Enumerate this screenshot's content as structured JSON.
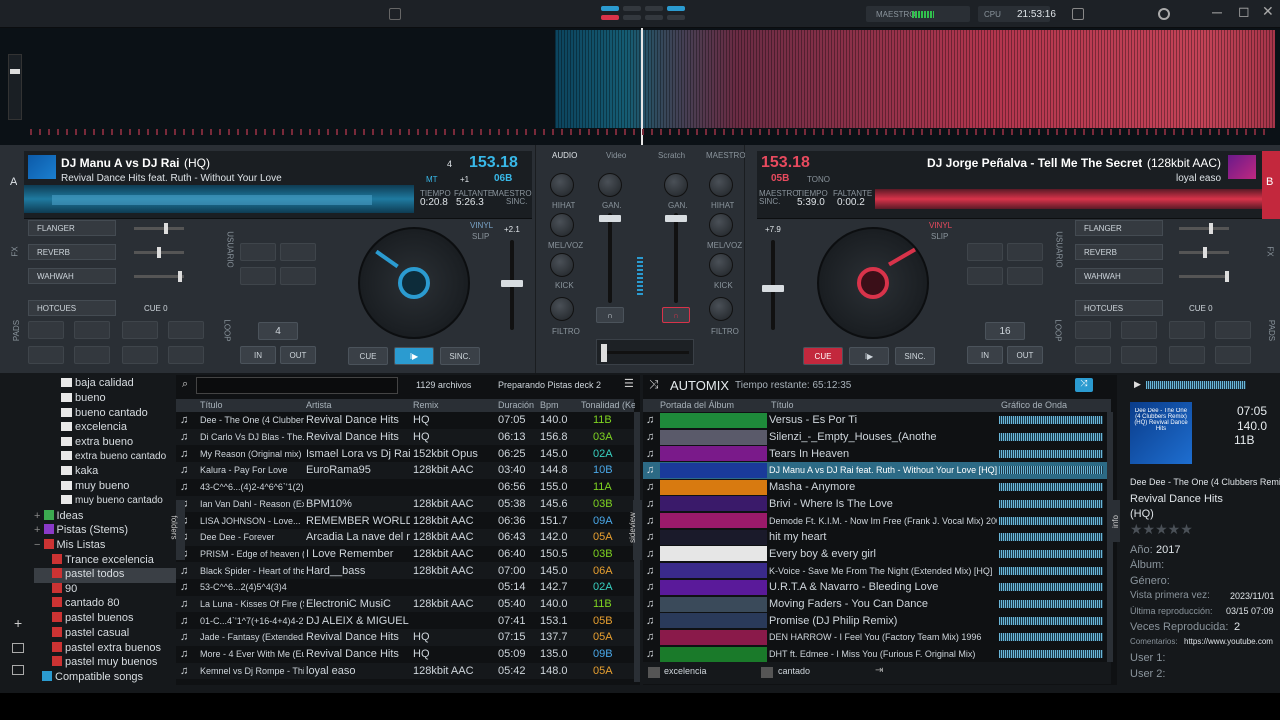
{
  "topbar": {
    "master_label": "MAESTRO",
    "cpu_label": "CPU",
    "clock": "21:53:16"
  },
  "deckA": {
    "letter": "A",
    "title": "DJ Manu A vs DJ Rai",
    "title_tag": "(HQ)",
    "subtitle": "Revival Dance Hits feat. Ruth - Without Your Love",
    "bpm": "153.18",
    "mt": "MT",
    "pitch": "+1",
    "key": "06B",
    "small_num": "4",
    "time_label": "TIEMPO",
    "time": "0:20.8",
    "remain_label": "FALTANTE",
    "remain": "5:26.3",
    "master_label": "MAESTRO",
    "sync_label": "SINC.",
    "fx": [
      "FLANGER",
      "REVERB",
      "WAHWAH"
    ],
    "hotcues": "HOTCUES",
    "cue_label": "CUE 0",
    "loop_val": "4",
    "in": "IN",
    "out": "OUT",
    "cue": "CUE",
    "sync": "SINC.",
    "pitch_val": "+2.1",
    "vinyl": "VINYL",
    "slip": "SLIP",
    "side_fx": "FX",
    "side_pads": "PADS",
    "side_user": "USUARIO",
    "side_loop": "LOOP"
  },
  "deckB": {
    "letter": "B",
    "title": "DJ Jorge Peñalva - Tell Me The Secret",
    "title_tag": "(128kbit AAC)",
    "subtitle": "loyal easo",
    "bpm": "153.18",
    "key": "05B",
    "tono_label": "TONO",
    "time_label": "TIEMPO",
    "time": "5:39.0",
    "remain_label": "FALTANTE",
    "remain": "0:00.2",
    "master_label": "MAESTRO",
    "sync_label": "SINC.",
    "fx": [
      "FLANGER",
      "REVERB",
      "WAHWAH"
    ],
    "hotcues": "HOTCUES",
    "cue_label": "CUE 0",
    "loop_val": "16",
    "in": "IN",
    "out": "OUT",
    "cue": "CUE",
    "sync": "SINC.",
    "pitch_val": "+7.9",
    "vinyl": "VINYL",
    "slip": "SLIP",
    "side_fx": "FX",
    "side_pads": "PADS",
    "side_user": "USUARIO",
    "side_loop": "LOOP"
  },
  "mixer": {
    "tabs": [
      "AUDIO",
      "Video",
      "Scratch",
      "MAESTRO"
    ],
    "hihat": "HIHAT",
    "melvoz": "MEL/VOZ",
    "kick": "KICK",
    "filtro": "FILTRO",
    "gan": "GAN."
  },
  "sidebar": {
    "items": [
      "baja calidad",
      "bueno",
      "bueno cantado",
      "excelencia",
      "extra bueno",
      "extra bueno cantado",
      "kaka",
      "muy bueno",
      "muy bueno cantado"
    ],
    "ideas": "Ideas",
    "stems": "Pistas (Stems)",
    "mis_listas": "Mis Listas",
    "lists": [
      "Trance excelencia",
      "pastel todos",
      "90",
      "cantado 80",
      "pastel buenos",
      "pastel casual",
      "pastel extra buenos",
      "pastel muy buenos"
    ],
    "compatible": "Compatible songs"
  },
  "filelist": {
    "count": "1129 archivos",
    "status": "Preparando Pistas deck 2",
    "side_tab": "folders",
    "headers": [
      "Título",
      "Artista",
      "Remix",
      "Duración",
      "Bpm",
      "Tonalidad (Ke"
    ],
    "rows": [
      [
        "Dee - The One (4 Clubbers Re",
        "Revival Dance Hits",
        "HQ",
        "07:05",
        "140.0",
        "11B",
        "g"
      ],
      [
        "Di Carlo Vs DJ Blas - The...",
        "Revival Dance Hits",
        "HQ",
        "06:13",
        "156.8",
        "03A",
        "g"
      ],
      [
        "My Reason (Original mix)",
        "Ismael Lora vs Dj Rai",
        "152kbit Opus",
        "06:25",
        "145.0",
        "02A",
        "c"
      ],
      [
        "Kalura - Pay For Love",
        "EuroRama95",
        "128kbit AAC",
        "03:40",
        "144.8",
        "10B",
        "b"
      ],
      [
        "43-C^^6...(4)2-4^6^6`'1(2)7(1)",
        "",
        "",
        "06:56",
        "155.0",
        "11A",
        "g"
      ],
      [
        "Ian Van Dahl - Reason (Ext...",
        "BPM10%",
        "128kbit AAC",
        "05:38",
        "145.6",
        "03B",
        "g"
      ],
      [
        "LISA JOHNSON - Love...",
        "REMEMBER WORLD",
        "128kbit AAC",
        "06:36",
        "151.7",
        "09A",
        "b"
      ],
      [
        "Dee Dee - Forever",
        "Arcadia La nave del recuerdo",
        "128kbit AAC",
        "06:43",
        "142.0",
        "05A",
        "o"
      ],
      [
        "PRISM - Edge of heaven (R...",
        "I Love Remember",
        "128kbit AAC",
        "06:40",
        "150.5",
        "03B",
        "g"
      ],
      [
        "Black Spider - Heart of the s...",
        "Hard__bass",
        "128kbit AAC",
        "07:00",
        "145.0",
        "06A",
        "o"
      ],
      [
        "53-C^^6...2(4)5^4(3)4",
        "",
        "",
        "05:14",
        "142.7",
        "02A",
        "c"
      ],
      [
        "La Luna - Kisses Of Fire (S...",
        "ElectroniC MusiC",
        "128kbit AAC",
        "05:40",
        "140.0",
        "11B",
        "g"
      ],
      [
        "01-C...4`'1^7(+16-4+4)4-2(...",
        "DJ ALEIX & MIGUEL SASS...",
        "",
        "07:41",
        "153.1",
        "05B",
        "o"
      ],
      [
        "Jade - Fantasy (Extended...",
        "Revival Dance Hits",
        "HQ",
        "07:15",
        "137.7",
        "05A",
        "o"
      ],
      [
        "More - 4 Ever With Me (Eur...",
        "Revival Dance Hits",
        "HQ",
        "05:09",
        "135.0",
        "09B",
        "b"
      ],
      [
        "Kemnel vs Dj Rompe - This...",
        "loyal easo",
        "128kbit AAC",
        "05:42",
        "148.0",
        "05A",
        "o"
      ]
    ]
  },
  "automix": {
    "title": "AUTOMIX",
    "remaining": "Tiempo restante: 65:12:35",
    "headers": [
      "Portada del Álbum",
      "Título",
      "Gráfico de Onda"
    ],
    "side_tab": "sideview",
    "rows": [
      "Versus - Es Por Ti",
      "Silenzi_-_Empty_Houses_(Anothe",
      "Tears In Heaven",
      "DJ Manu A vs DJ Rai feat. Ruth - Without Your Love [HQ]",
      "Masha - Anymore",
      "Brivi - Where Is The Love",
      "Demode Ft. K.I.M. - Now Im Free (Frank J. Vocal Mix) 2002  Nrg",
      "hit my heart",
      "Every boy & every girl",
      "K-Voice - Save Me From The Night (Extended Mix) [HQ]",
      "U.R.T.A & Navarro - Bleeding Love",
      "Moving Faders - You Can Dance",
      "Promise (DJ Philip Remix)",
      "DEN HARROW - I Feel You (Factory Team Mix) 1996",
      "DHT ft. Edmee - I Miss You (Furious F. Original Mix)"
    ],
    "bottom_tabs": [
      "excelencia",
      "cantado"
    ]
  },
  "info": {
    "side_tab": "info",
    "time": "07:05",
    "bpm": "140.0",
    "key": "11B",
    "cover_text": "Dee Dee - The One (4 Clubbers Remix) (HQ) Revival Dance Hits",
    "title": "Dee Dee - The One (4 Clubbers Remix)",
    "artist": "Revival Dance Hits",
    "remix": "(HQ)",
    "year_label": "Año:",
    "year": "2017",
    "album_label": "Álbum:",
    "genre_label": "Género:",
    "first_seen_label": "Vista primera vez:",
    "first_seen": "2023/11/01",
    "last_play_label": "Última reproducción:",
    "last_play": "03/15 07:09",
    "plays_label": "Veces Reproducida:",
    "plays": "2",
    "comments_label": "Comentarios:",
    "comments": "https://www.youtube.com",
    "user1_label": "User 1:",
    "user2_label": "User 2:"
  }
}
